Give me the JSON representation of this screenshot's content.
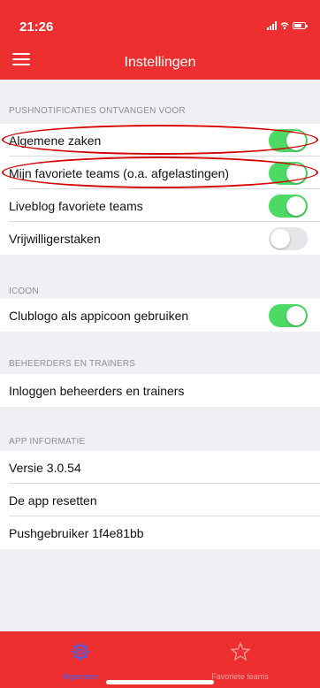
{
  "status_bar": {
    "time": "21:26"
  },
  "header": {
    "title": "Instellingen"
  },
  "sections": {
    "push": {
      "title": "PUSHNOTIFICATIES ONTVANGEN VOOR",
      "items": [
        {
          "label": "Algemene zaken",
          "enabled": true
        },
        {
          "label": "Mijn favoriete teams (o.a. afgelastingen)",
          "enabled": true
        },
        {
          "label": "Liveblog favoriete teams",
          "enabled": true
        },
        {
          "label": "Vrijwilligerstaken",
          "enabled": false
        }
      ]
    },
    "icon": {
      "title": "ICOON",
      "items": [
        {
          "label": "Clublogo als appicoon gebruiken",
          "enabled": true
        }
      ]
    },
    "admins": {
      "title": "BEHEERDERS EN TRAINERS",
      "items": [
        {
          "label": "Inloggen beheerders en trainers"
        }
      ]
    },
    "app_info": {
      "title": "APP INFORMATIE",
      "items": [
        {
          "label": "Versie 3.0.54"
        },
        {
          "label": "De app resetten"
        },
        {
          "label": "Pushgebruiker 1f4e81bb"
        }
      ]
    }
  },
  "tabbar": {
    "tabs": [
      {
        "label": "Algemeen",
        "icon": "gear-icon",
        "active": true
      },
      {
        "label": "Favoriete teams",
        "icon": "star-icon",
        "active": false
      }
    ]
  },
  "colors": {
    "brand_red": "#ee2f2f",
    "toggle_on": "#4cd964",
    "toggle_off": "#e5e5ea",
    "tab_active": "#3d63ff",
    "tab_inactive": "#f7a0a0",
    "annotation": "#d40000"
  }
}
